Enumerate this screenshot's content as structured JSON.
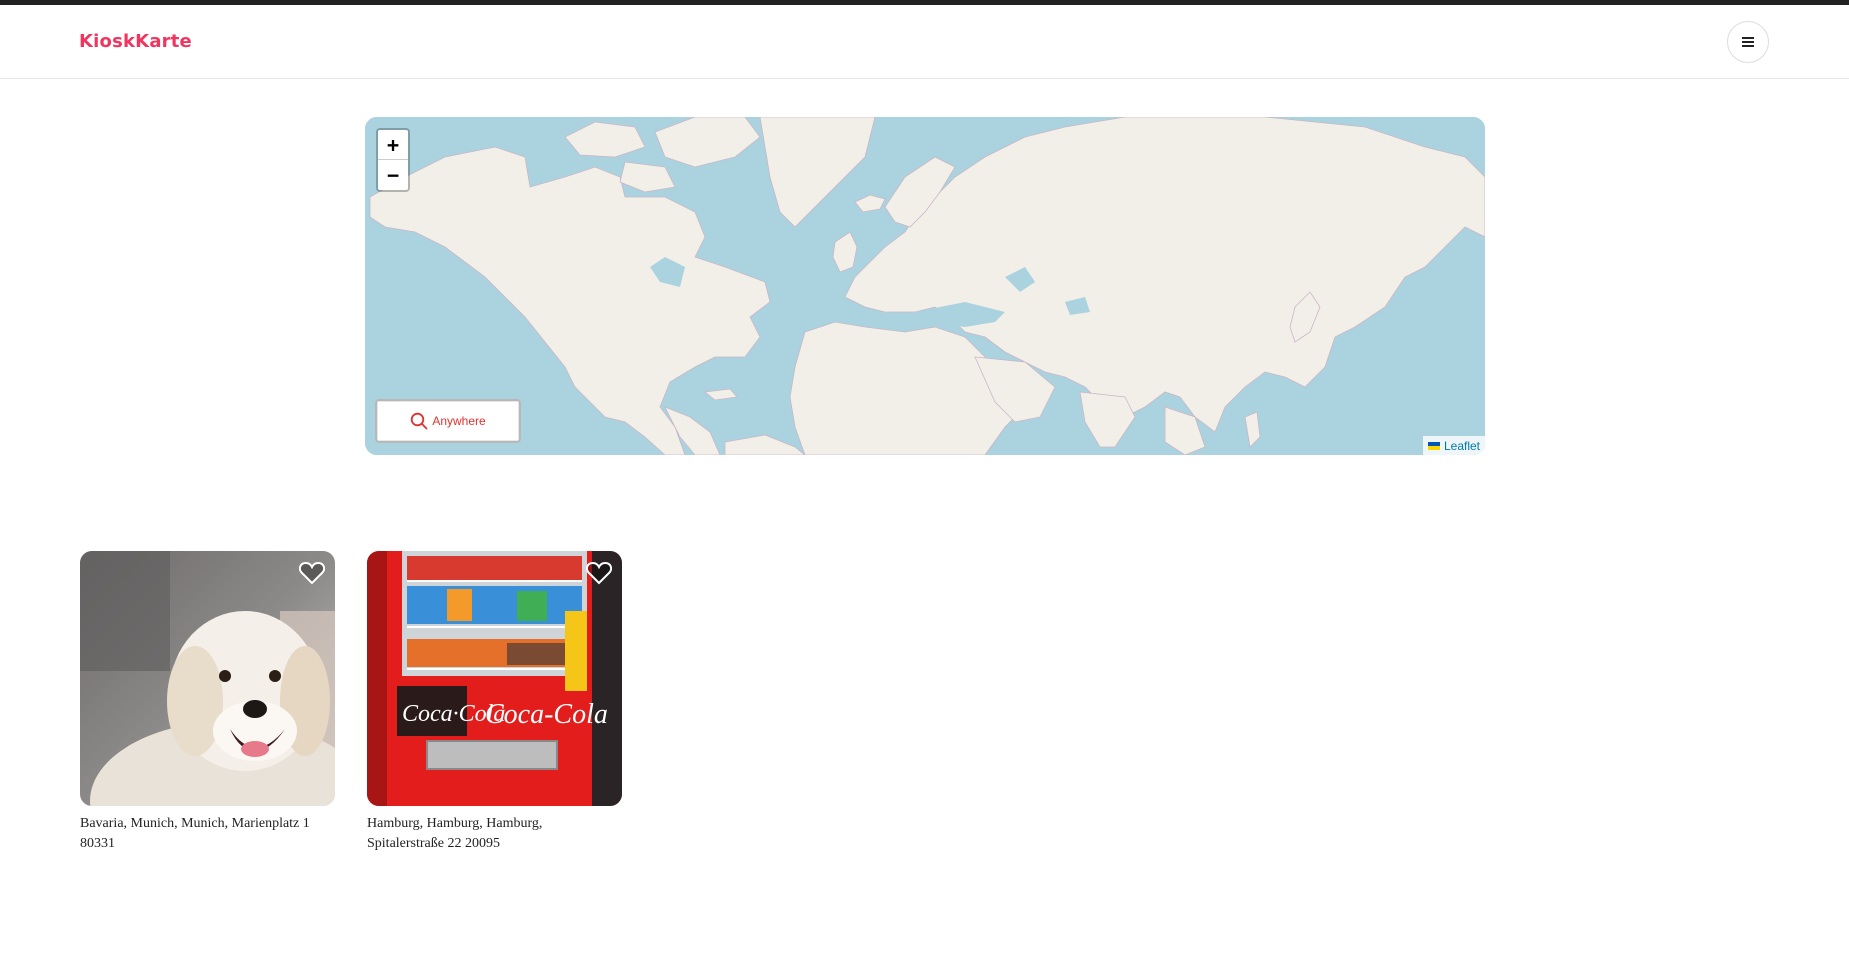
{
  "app": {
    "logo": "KioskKarte",
    "brand_color": "#f0365f"
  },
  "header": {
    "menu_icon": "hamburger-menu-icon"
  },
  "map": {
    "zoom_in": "+",
    "zoom_out": "−",
    "search_label": "Anywhere",
    "search_icon": "magnifier-icon",
    "attribution": "Leaflet",
    "water_color": "#aad3df",
    "land_color": "#f2efe9"
  },
  "listings": [
    {
      "address": "Bavaria, Munich, Munich, Marienplatz 1 80331",
      "image": "dog-photo",
      "favorite_icon": "heart-icon"
    },
    {
      "address": "Hamburg, Hamburg, Hamburg, Spitalerstraße 22 20095",
      "image": "vending-machine-photo",
      "favorite_icon": "heart-icon"
    }
  ]
}
